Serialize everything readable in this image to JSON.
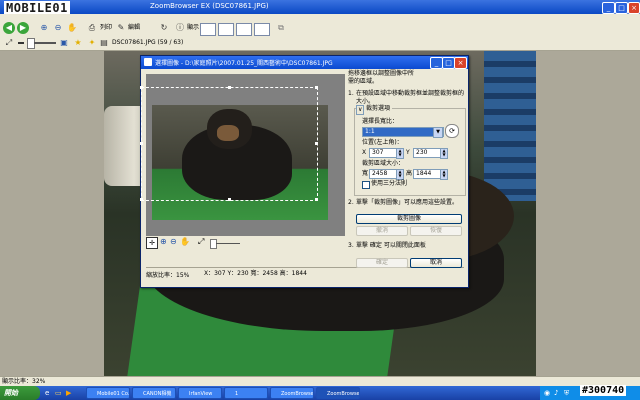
{
  "app": {
    "logo": "MOBILE01",
    "window_title": "ZoomBrowser EX (DSC07861.JPG)",
    "filename_info": "DSC07861.JPG (59 / 63)"
  },
  "toolbar": {
    "view_label": "顯示",
    "print_label": "列印",
    "edit_label": "編輯"
  },
  "dialog": {
    "title": "選擇圖像 - D:\\家庭照片\\2007.01.25_關西藝術中\\DSC07861.JPG",
    "instruction_main": "拖移邊框以調整圖像中所需的區域。",
    "step1": "在預設區域中移動裁剪框並調整裁剪框的大小。",
    "section_label": "裁剪選項",
    "ratio_label": "選擇長寬比：",
    "ratio_value": "1:1",
    "position_label": "位置(左上角)：",
    "x_label": "X",
    "x_value": "307",
    "y_label": "Y",
    "y_value": "230",
    "size_label": "裁剪區域大小：",
    "width_label": "寬",
    "width_value": "2458",
    "height_label": "高",
    "height_value": "1844",
    "checkbox_label": "使用三分法則",
    "step2": "單擊「裁剪圖像」可以應用這些設置。",
    "crop_button": "裁剪圖像",
    "undo_button": "撤消",
    "redo_button": "恢復",
    "step3": "單擊 確定 可以關閉此面板",
    "ok_button": "確定",
    "cancel_button": "取消",
    "status_zoom": "縮放比率：15%",
    "status_coords": "X：307 Y：230 寬：2458 高：1844"
  },
  "statusbar": {
    "zoom": "顯示比率：32%"
  },
  "taskbar": {
    "start": "開始",
    "tasks": [
      "Mobile01 Co...",
      "CANON相機",
      "IrfanView",
      "1",
      "ZoomBrowser...",
      "ZoomBrowser..."
    ],
    "watermark": "#300740"
  }
}
